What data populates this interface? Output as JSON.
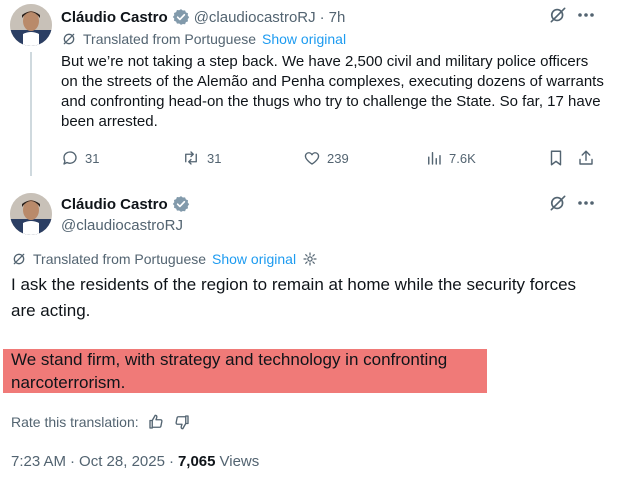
{
  "reply_tweet": {
    "author_name": "Cláudio Castro",
    "handle": "@claudiocastroRJ",
    "separator": "·",
    "age": "7h",
    "translated_label": "Translated from Portuguese",
    "show_original": "Show original",
    "text": "But we’re not taking a step back. We have 2,500 civil and military police officers on the streets of the Alemão and Penha complexes, executing dozens of warrants and confronting head-on the thugs who try to challenge the State. So far, 17 have been arrested.",
    "stats": {
      "replies": "31",
      "reposts": "31",
      "likes": "239",
      "views": "7.6K"
    }
  },
  "main_tweet": {
    "author_name": "Cláudio Castro",
    "handle": "@claudiocastroRJ",
    "translated_label": "Translated from Portuguese",
    "show_original": "Show original",
    "text_plain": "I ask the residents of the region to remain at home while the security forces are acting.",
    "text_highlighted": "We stand firm, with strategy and technology in confronting narcoterrorism.",
    "highlight_color": "#f07a78",
    "rate_label": "Rate this translation:",
    "time": "7:23 AM",
    "date_sep": "·",
    "date": "Oct 28, 2025",
    "views_sep": "·",
    "views_count": "7,065",
    "views_label": "Views"
  },
  "colors": {
    "verified_badge": "#829aab",
    "link": "#1d9bf0",
    "muted": "#536471",
    "thread_line": "#cfd9de"
  }
}
